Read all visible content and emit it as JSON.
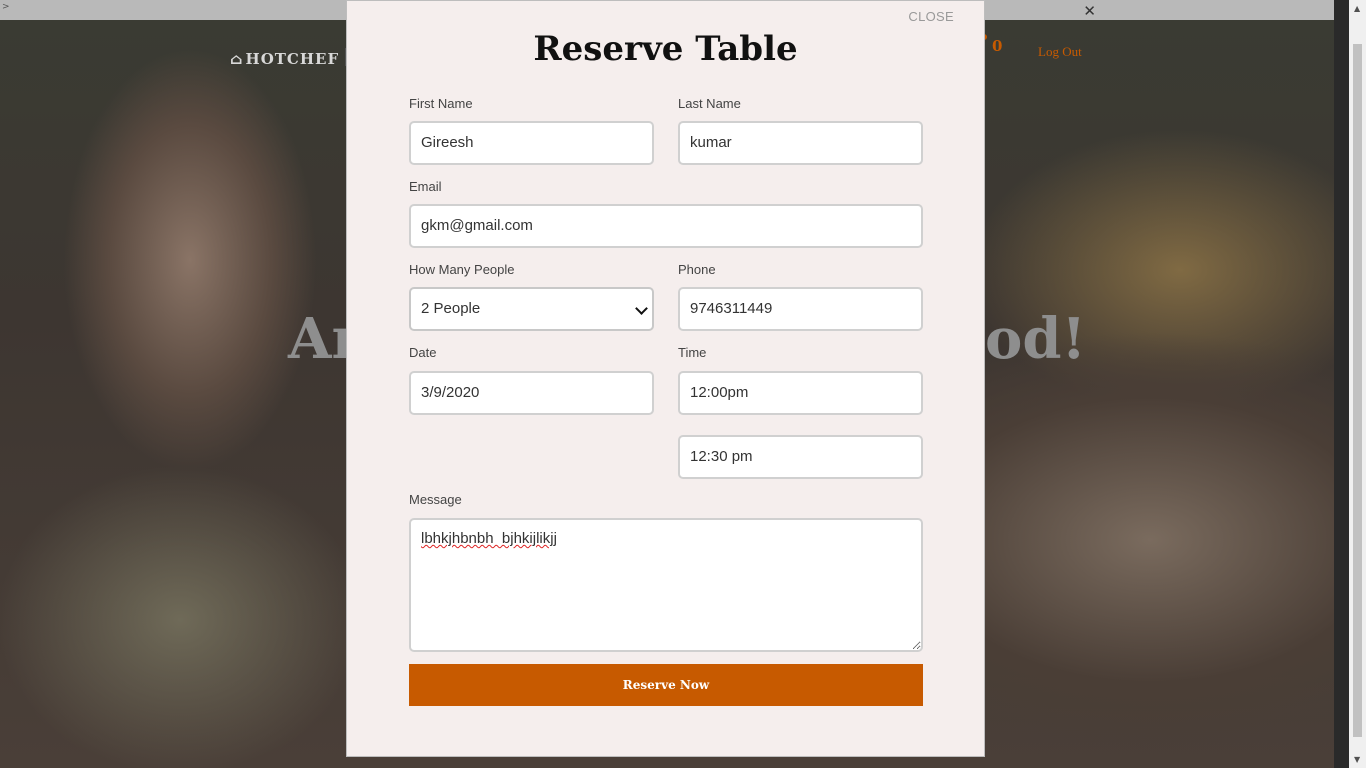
{
  "background": {
    "nav": {
      "logo": "HOTCHEF",
      "cart_count": "0",
      "logout": "Log Out"
    },
    "hero": {
      "visible_left": "An",
      "visible_right": "od!"
    }
  },
  "modal": {
    "close": "CLOSE",
    "title": "Reserve Table",
    "fields": {
      "first_name": {
        "label": "First Name",
        "value": "Gireesh"
      },
      "last_name": {
        "label": "Last Name",
        "value": "kumar"
      },
      "email": {
        "label": "Email",
        "value": "gkm@gmail.com"
      },
      "people": {
        "label": "How Many People",
        "value": "2 People"
      },
      "phone": {
        "label": "Phone",
        "value": "9746311449"
      },
      "date": {
        "label": "Date",
        "value": "3/9/2020"
      },
      "time": {
        "label": "Time",
        "value": "12:00pm"
      },
      "time_end": {
        "value": "12:30 pm"
      },
      "message": {
        "label": "Message",
        "value": "lbhkjhbnbh  bjhkijlikjj"
      }
    },
    "submit": "Reserve Now",
    "colors": {
      "accent": "#c75a00",
      "modal_bg": "#f5eeed"
    }
  }
}
